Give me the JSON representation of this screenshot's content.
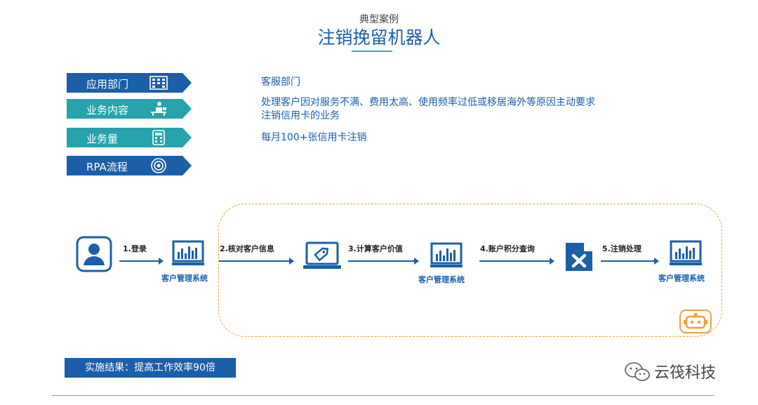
{
  "header": {
    "subtitle": "典型案例",
    "title": "注销挽留机器人"
  },
  "tags": [
    {
      "label": "应用部门",
      "icon": "building-grid-icon",
      "color": "#1a5fa8"
    },
    {
      "label": "业务内容",
      "icon": "person-at-desk-icon",
      "color": "#26a3ad"
    },
    {
      "label": "业务量",
      "icon": "calculator-icon",
      "color": "#26a3ad"
    },
    {
      "label": "RPA流程",
      "icon": "target-icon",
      "color": "#1a5fa8"
    }
  ],
  "info": {
    "department": "客服部门",
    "content_line1": "处理客户因对服务不满、费用太高、使用频率过低或移居海外等原因主动要求",
    "content_line2": "注销信用卡的业务",
    "volume": "每月100+张信用卡注销"
  },
  "flow": {
    "steps": [
      "1.登录",
      "2.核对客户信息",
      "3.计算客户价值",
      "4.账户积分查询",
      "5.注销处理"
    ],
    "system_label": "客户管理系统"
  },
  "result": "实施结果：提高工作效率90倍",
  "watermark": "云筏科技",
  "colors": {
    "primary": "#1a5fa8",
    "teal": "#26a3ad",
    "dash": "#f0a040"
  }
}
